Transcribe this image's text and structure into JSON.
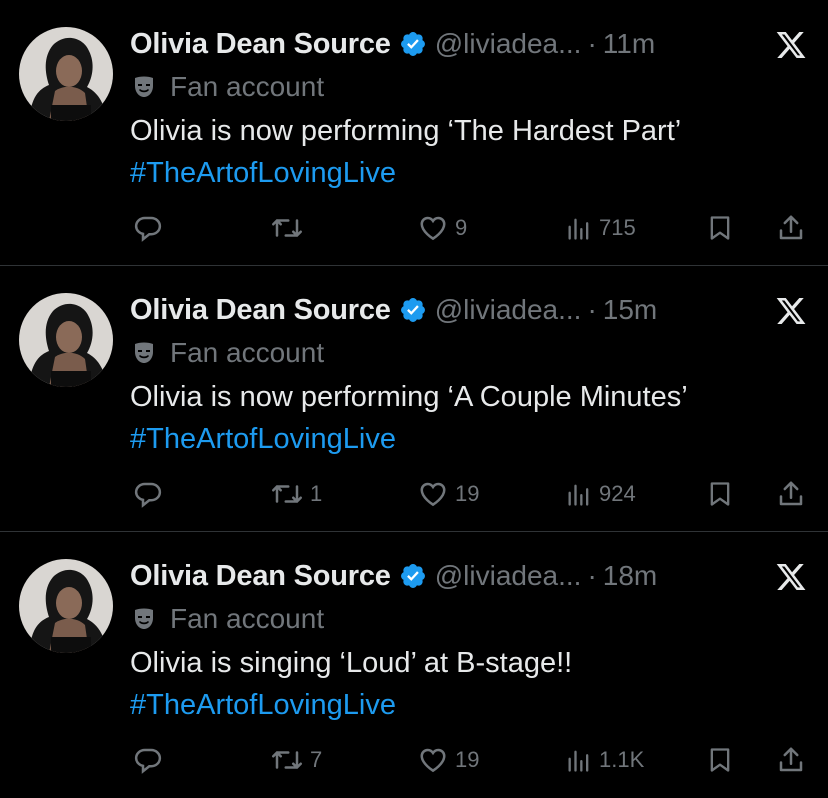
{
  "colors": {
    "background": "#000000",
    "text": "#e7e9ea",
    "muted": "#71767b",
    "accent": "#1d9bf0",
    "divider": "#2f3336"
  },
  "tweets": [
    {
      "name": "Olivia Dean Source",
      "handle": "@liviadea...",
      "separator": "·",
      "time": "11m",
      "label": "Fan account",
      "text": "Olivia is now performing ‘The Hardest Part’",
      "hashtag": "#TheArtofLovingLive",
      "replies": "",
      "retweets": "",
      "likes": "9",
      "views": "715"
    },
    {
      "name": "Olivia Dean Source",
      "handle": "@liviadea...",
      "separator": "·",
      "time": "15m",
      "label": "Fan account",
      "text": "Olivia is now performing ‘A Couple Minutes’",
      "hashtag": "#TheArtofLovingLive",
      "replies": "",
      "retweets": "1",
      "likes": "19",
      "views": "924"
    },
    {
      "name": "Olivia Dean Source",
      "handle": "@liviadea...",
      "separator": "·",
      "time": "18m",
      "label": "Fan account",
      "text": "Olivia is singing ‘Loud’ at B-stage!!",
      "hashtag": "#TheArtofLovingLive",
      "replies": "",
      "retweets": "7",
      "likes": "19",
      "views": "1.1K"
    }
  ],
  "icons": {
    "avatar": "profile-photo",
    "verified": "verified-badge-icon",
    "x": "x-logo-icon",
    "label": "theater-mask-icon",
    "reply": "reply-icon",
    "retweet": "retweet-icon",
    "like": "heart-icon",
    "views": "views-icon",
    "bookmark": "bookmark-icon",
    "share": "share-icon"
  }
}
